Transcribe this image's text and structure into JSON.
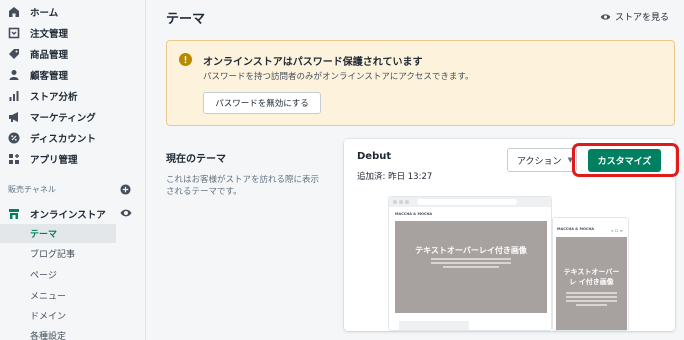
{
  "sidebar": {
    "items": [
      {
        "label": "ホーム",
        "icon": "home-icon"
      },
      {
        "label": "注文管理",
        "icon": "orders-icon"
      },
      {
        "label": "商品管理",
        "icon": "products-icon"
      },
      {
        "label": "顧客管理",
        "icon": "customers-icon"
      },
      {
        "label": "ストア分析",
        "icon": "analytics-icon"
      },
      {
        "label": "マーケティング",
        "icon": "marketing-icon"
      },
      {
        "label": "ディスカウント",
        "icon": "discount-icon"
      },
      {
        "label": "アプリ管理",
        "icon": "apps-icon"
      }
    ],
    "sales_channels_label": "販売チャネル",
    "online_store_label": "オンラインストア",
    "sub_items": [
      {
        "label": "テーマ",
        "active": true
      },
      {
        "label": "ブログ記事",
        "active": false
      },
      {
        "label": "ページ",
        "active": false
      },
      {
        "label": "メニュー",
        "active": false
      },
      {
        "label": "ドメイン",
        "active": false
      },
      {
        "label": "各種設定",
        "active": false
      }
    ]
  },
  "header": {
    "title": "テーマ",
    "view_store": "ストアを見る"
  },
  "banner": {
    "title": "オンラインストアはパスワード保護されています",
    "text": "パスワードを持つ訪問者のみがオンラインストアにアクセスできます。",
    "button": "パスワードを無効にする"
  },
  "current_theme": {
    "title": "現在のテーマ",
    "description": "これはお客様がストアを訪れる際に表示されるテーマです。"
  },
  "theme_card": {
    "name": "Debut",
    "added": "追加済: 昨日 13:27",
    "actions_label": "アクション",
    "customize_label": "カスタマイズ",
    "preview": {
      "brand": "MACCHA & MOCHA",
      "hero_text": "テキストオーバーレイ付き画像",
      "mobile_hero_text": "テキストオーバーレ イ付き画像"
    }
  },
  "colors": {
    "primary": "#008060",
    "highlight": "#e01b1b",
    "banner_bg": "#fdf3dc"
  }
}
